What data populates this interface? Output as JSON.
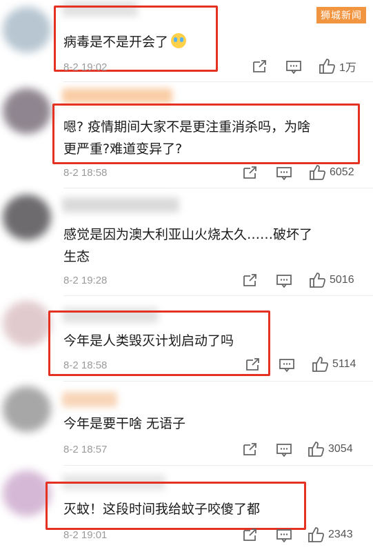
{
  "watermark": "狮城新闻",
  "comments": [
    {
      "text": "病毒是不是开会了",
      "time": "8-2 19:02",
      "likes": "1万"
    },
    {
      "text": "嗯? 疫情期间大家不是更注重消杀吗，为啥\n更严重?难道变异了?",
      "time": "8-2 18:58",
      "likes": "6052"
    },
    {
      "text": "感觉是因为澳大利亚山火烧太久……破坏了\n生态",
      "time": "8-2 19:28",
      "likes": "5016"
    },
    {
      "text": "今年是人类毁灭计划启动了吗",
      "time": "8-2 18:58",
      "likes": "5114"
    },
    {
      "text": "今年是要干啥 无语子",
      "time": "8-2 18:57",
      "likes": "3054"
    },
    {
      "text": "灭蚊！这段时间我给蚊子咬傻了都",
      "time": "8-2 19:01",
      "likes": "2343"
    }
  ],
  "colors": {
    "highlight_box": "#e53122",
    "time_text": "#9a9a9a",
    "watermark_bg": "#f0821e"
  }
}
